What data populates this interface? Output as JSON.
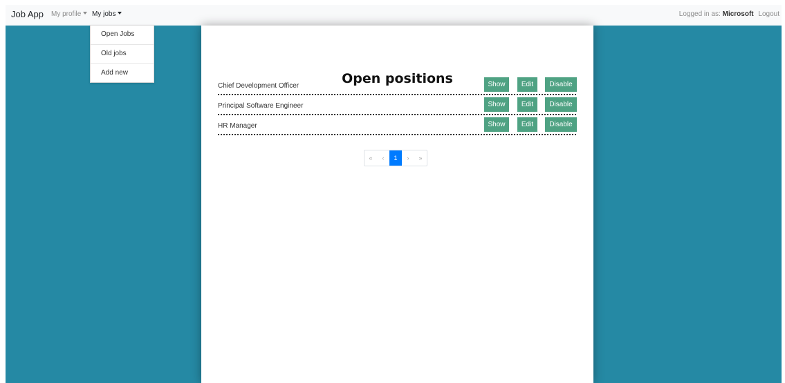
{
  "navbar": {
    "brand": "Job App",
    "my_profile": "My profile",
    "my_jobs": "My jobs",
    "logged_in_prefix": "Logged in as:",
    "username": "Microsoft",
    "logout": "Logout"
  },
  "dropdown": {
    "items": [
      "Open Jobs",
      "Old jobs",
      "Add new"
    ]
  },
  "main": {
    "title": "Open positions",
    "jobs": [
      {
        "name": "Chief Development Officer",
        "show": "Show",
        "edit": "Edit",
        "disable": "Disable"
      },
      {
        "name": "Principal Software Engineer",
        "show": "Show",
        "edit": "Edit",
        "disable": "Disable"
      },
      {
        "name": "HR Manager",
        "show": "Show",
        "edit": "Edit",
        "disable": "Disable"
      }
    ]
  },
  "pagination": {
    "first": "«",
    "prev": "‹",
    "current": "1",
    "next": "›",
    "last": "»"
  },
  "colors": {
    "background": "#2589a4",
    "button": "#4fa283",
    "page_active": "#007bff"
  }
}
